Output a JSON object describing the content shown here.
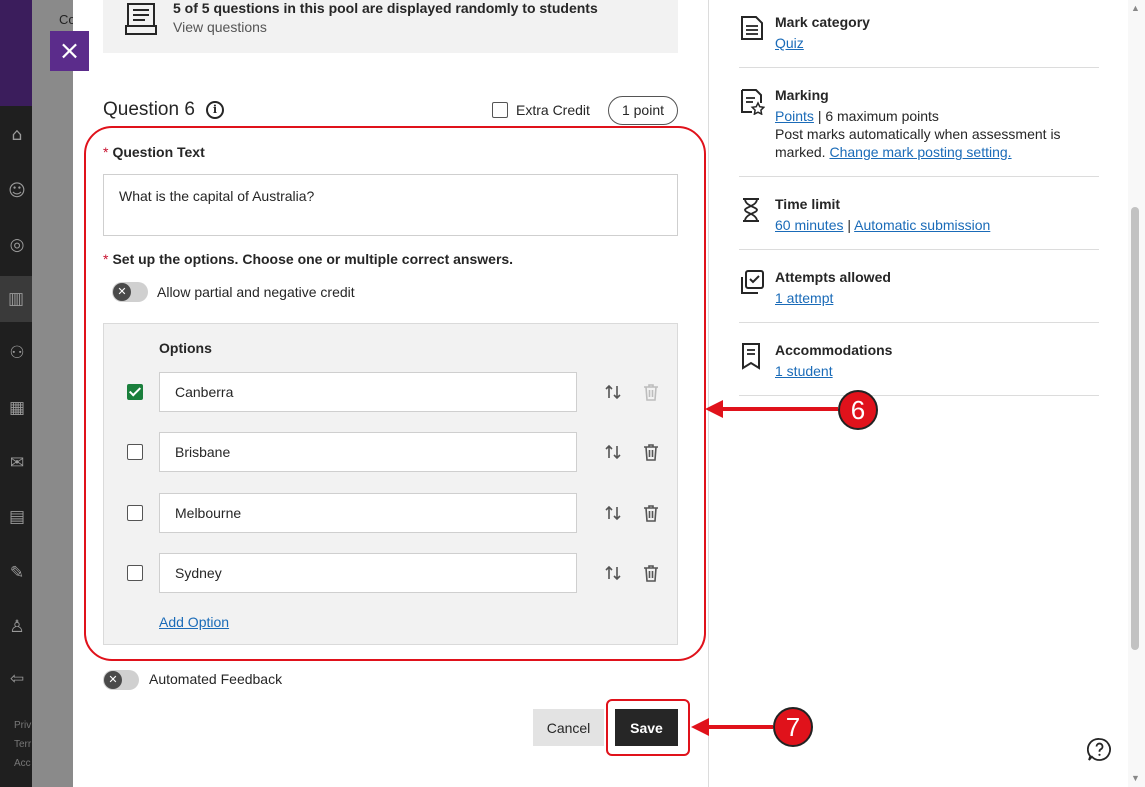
{
  "background": {
    "course_abbrev": "Co",
    "footer_lines": [
      "Priv",
      "Terr",
      "Acc"
    ]
  },
  "pool": {
    "text": "5 of 5 questions in this pool are displayed randomly to students",
    "link": "View questions"
  },
  "question": {
    "title": "Question 6",
    "extra_credit_label": "Extra Credit",
    "points": "1 point",
    "text_label": "Question Text",
    "text_value": "What is the capital of Australia?",
    "options_instruction": "Set up the options. Choose one or multiple correct answers.",
    "partial_credit_label": "Allow partial and negative credit",
    "options_header": "Options",
    "options": [
      {
        "label": "Canberra",
        "correct": true
      },
      {
        "label": "Brisbane",
        "correct": false
      },
      {
        "label": "Melbourne",
        "correct": false
      },
      {
        "label": "Sydney",
        "correct": false
      }
    ],
    "add_option": "Add Option",
    "automated_feedback_label": "Automated Feedback",
    "cancel_label": "Cancel",
    "save_label": "Save"
  },
  "settings": {
    "mark_category": {
      "title": "Mark category",
      "value": "Quiz"
    },
    "marking": {
      "title": "Marking",
      "points_link": "Points",
      "separator": "|",
      "max_points": "6 maximum points",
      "post_text": "Post marks automatically when assessment is marked.",
      "change_link": "Change mark posting setting."
    },
    "time_limit": {
      "title": "Time limit",
      "minutes_link": "60 minutes",
      "separator": "|",
      "submission_link": "Automatic submission"
    },
    "attempts": {
      "title": "Attempts allowed",
      "value": "1 attempt"
    },
    "accommodations": {
      "title": "Accommodations",
      "value": "1 student"
    }
  },
  "callouts": {
    "step6": "6",
    "step7": "7"
  },
  "icons": {
    "close": "close-icon",
    "pool": "question-pool-icon",
    "info": "info-icon",
    "reorder": "reorder-icon",
    "delete": "trash-icon",
    "help": "help-icon"
  },
  "colors": {
    "accent_purple": "#5b2c8b",
    "annotation_red": "#e0121b",
    "correct_green": "#1a7f3c",
    "link_blue": "#1a6bb8"
  }
}
